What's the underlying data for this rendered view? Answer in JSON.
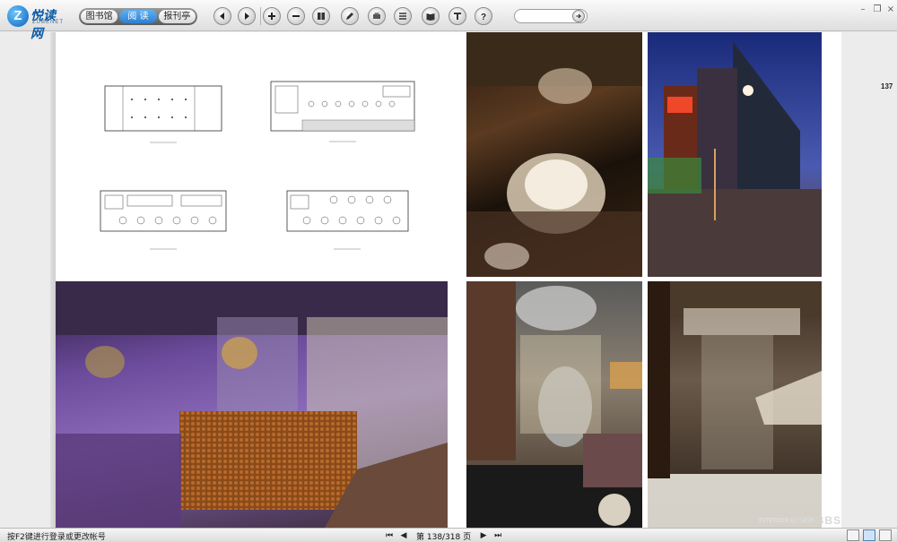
{
  "toolbar": {
    "logo_text": "悦读网",
    "logo_sub": "ZUBENET",
    "tabs": [
      {
        "label": "图书馆",
        "active": false
      },
      {
        "label": "阅 读",
        "active": true
      },
      {
        "label": "报刊亭",
        "active": false
      }
    ],
    "search_value": "",
    "icons": [
      "prev-page-icon",
      "next-page-icon",
      "zoom-in-icon",
      "zoom-out-icon",
      "bookmark-icon",
      "annotate-icon",
      "print-icon",
      "toc-icon",
      "book-icon",
      "text-icon",
      "help-icon"
    ]
  },
  "window_controls": [
    "minimize",
    "restore",
    "close"
  ],
  "page": {
    "number_label": "137",
    "watermark": "INTERIOR DESIGN",
    "watermark_site": "MT-BBS"
  },
  "status": {
    "message": "按F2键进行登录或更改帐号",
    "page_indicator": "第 138/318 页"
  },
  "colors": {
    "accent": "#2f7fd0",
    "toolbar_bg": "#e6e6e6",
    "page_bg": "#ffffff"
  }
}
